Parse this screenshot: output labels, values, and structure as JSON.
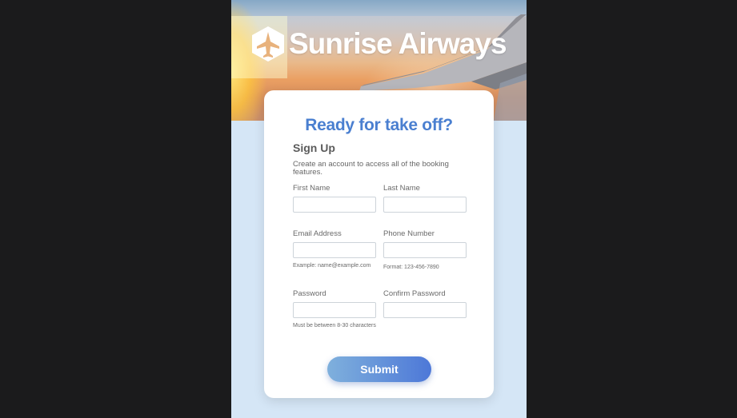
{
  "brand": {
    "name": "Sunrise Airways",
    "logo_icon": "plane-icon"
  },
  "form": {
    "headline": "Ready for take off?",
    "title": "Sign Up",
    "description": "Create an account to access all of the booking features.",
    "fields": {
      "first_name": {
        "label": "First Name",
        "value": ""
      },
      "last_name": {
        "label": "Last Name",
        "value": ""
      },
      "email": {
        "label": "Email Address",
        "value": "",
        "hint": "Example: name@example.com"
      },
      "phone": {
        "label": "Phone Number",
        "value": "",
        "hint": "Format: 123-456-7890"
      },
      "password": {
        "label": "Password",
        "value": "",
        "hint": "Must be between 8-30 characters"
      },
      "confirm_password": {
        "label": "Confirm Password",
        "value": ""
      }
    },
    "submit_label": "Submit"
  },
  "colors": {
    "accent": "#4a7fd0",
    "page_background": "#d5e6f6",
    "button_gradient_start": "#7fb0dc",
    "button_gradient_end": "#4d78d8"
  }
}
